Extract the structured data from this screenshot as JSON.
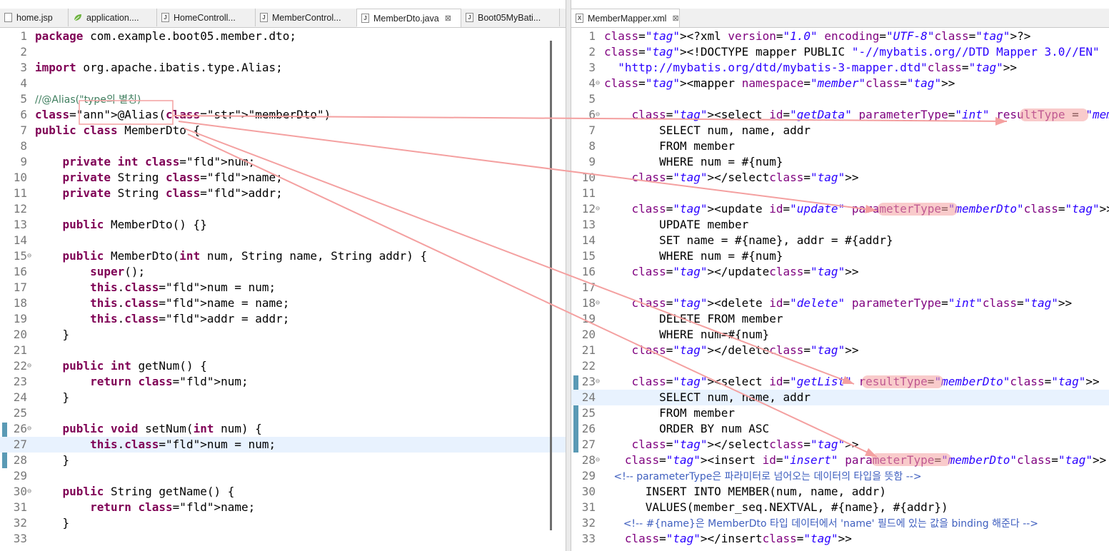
{
  "left_tabs": [
    {
      "label": "home.jsp",
      "icon": "jsp-file-icon",
      "active": false
    },
    {
      "label": "application....",
      "icon": "spring-leaf-icon",
      "active": false
    },
    {
      "label": "HomeControll...",
      "icon": "java-file-icon",
      "active": false
    },
    {
      "label": "MemberControl...",
      "icon": "java-file-icon",
      "active": false
    },
    {
      "label": "MemberDto.java",
      "icon": "java-file-icon",
      "active": true,
      "close": "⊠"
    },
    {
      "label": "Boot05MyBati...",
      "icon": "java-file-icon",
      "active": false
    }
  ],
  "right_tabs": [
    {
      "label": "MemberMapper.xml",
      "icon": "xml-file-icon",
      "active": true,
      "close": "⊠"
    }
  ],
  "java_lines": [
    {
      "n": "1",
      "text": "package com.example.boot05.member.dto;"
    },
    {
      "n": "2",
      "text": ""
    },
    {
      "n": "3",
      "text": "import org.apache.ibatis.type.Alias;"
    },
    {
      "n": "4",
      "text": ""
    },
    {
      "n": "5",
      "text": "//@Alias(\"type의 별칭)"
    },
    {
      "n": "6",
      "text": "@Alias(\"memberDto\")"
    },
    {
      "n": "7",
      "text": "public class MemberDto {"
    },
    {
      "n": "8",
      "text": ""
    },
    {
      "n": "9",
      "text": "    private int num;"
    },
    {
      "n": "10",
      "text": "    private String name;"
    },
    {
      "n": "11",
      "text": "    private String addr;"
    },
    {
      "n": "12",
      "text": ""
    },
    {
      "n": "13",
      "text": "    public MemberDto() {}"
    },
    {
      "n": "14",
      "text": ""
    },
    {
      "n": "15",
      "text": "    public MemberDto(int num, String name, String addr) {",
      "fold": "⊖"
    },
    {
      "n": "16",
      "text": "        super();"
    },
    {
      "n": "17",
      "text": "        this.num = num;"
    },
    {
      "n": "18",
      "text": "        this.name = name;"
    },
    {
      "n": "19",
      "text": "        this.addr = addr;"
    },
    {
      "n": "20",
      "text": "    }"
    },
    {
      "n": "21",
      "text": ""
    },
    {
      "n": "22",
      "text": "    public int getNum() {",
      "fold": "⊖"
    },
    {
      "n": "23",
      "text": "        return num;"
    },
    {
      "n": "24",
      "text": "    }"
    },
    {
      "n": "25",
      "text": ""
    },
    {
      "n": "26",
      "text": "    public void setNum(int num) {",
      "fold": "⊖"
    },
    {
      "n": "27",
      "text": "        this.num = num;",
      "hl": true
    },
    {
      "n": "28",
      "text": "    }"
    },
    {
      "n": "29",
      "text": ""
    },
    {
      "n": "30",
      "text": "    public String getName() {",
      "fold": "⊖"
    },
    {
      "n": "31",
      "text": "        return name;"
    },
    {
      "n": "32",
      "text": "    }"
    },
    {
      "n": "33",
      "text": ""
    }
  ],
  "xml_lines": [
    {
      "n": "1",
      "text": "<?xml version=\"1.0\" encoding=\"UTF-8\"?>"
    },
    {
      "n": "2",
      "text": "<!DOCTYPE mapper PUBLIC \"-//mybatis.org//DTD Mapper 3.0//EN\""
    },
    {
      "n": "3",
      "text": "  \"http://mybatis.org/dtd/mybatis-3-mapper.dtd\">"
    },
    {
      "n": "4",
      "text": "<mapper namespace=\"member\">",
      "fold": "⊖"
    },
    {
      "n": "5",
      "text": ""
    },
    {
      "n": "6",
      "text": "    <select id=\"getData\" parameterType=\"int\" resultType = \"memberDto\">",
      "fold": "⊖"
    },
    {
      "n": "7",
      "text": "        SELECT num, name, addr"
    },
    {
      "n": "8",
      "text": "        FROM member"
    },
    {
      "n": "9",
      "text": "        WHERE num = #{num}"
    },
    {
      "n": "10",
      "text": "    </select>"
    },
    {
      "n": "11",
      "text": ""
    },
    {
      "n": "12",
      "text": "    <update id=\"update\" parameterType=\"memberDto\">",
      "fold": "⊖"
    },
    {
      "n": "13",
      "text": "        UPDATE member"
    },
    {
      "n": "14",
      "text": "        SET name = #{name}, addr = #{addr}"
    },
    {
      "n": "15",
      "text": "        WHERE num = #{num}"
    },
    {
      "n": "16",
      "text": "    </update>"
    },
    {
      "n": "17",
      "text": ""
    },
    {
      "n": "18",
      "text": "    <delete id=\"delete\" parameterType=\"int\">",
      "fold": "⊖"
    },
    {
      "n": "19",
      "text": "        DELETE FROM member"
    },
    {
      "n": "20",
      "text": "        WHERE num=#{num}"
    },
    {
      "n": "21",
      "text": "    </delete>"
    },
    {
      "n": "22",
      "text": ""
    },
    {
      "n": "23",
      "text": "    <select id=\"getList\" resultType=\"memberDto\">",
      "fold": "⊖"
    },
    {
      "n": "24",
      "text": "        SELECT num, name, addr",
      "hl": true
    },
    {
      "n": "25",
      "text": "        FROM member"
    },
    {
      "n": "26",
      "text": "        ORDER BY num ASC"
    },
    {
      "n": "27",
      "text": "    </select>"
    },
    {
      "n": "28",
      "text": "   <insert id=\"insert\" parameterType=\"memberDto\">",
      "fold": "⊖"
    },
    {
      "n": "29",
      "text": "   <!-- parameterType은 파라미터로 넘어오는 데이터의 타입을 뜻함 -->"
    },
    {
      "n": "30",
      "text": "      INSERT INTO MEMBER(num, name, addr)"
    },
    {
      "n": "31",
      "text": "      VALUES(member_seq.NEXTVAL, #{name}, #{addr})"
    },
    {
      "n": "32",
      "text": "      <!-- #{name}은 MemberDto 타입 데이터에서 'name' 필드에 있는 값을 binding 해준다 -->"
    },
    {
      "n": "33",
      "text": "   </insert>"
    }
  ],
  "colors": {
    "annotation": "#f4a0a0",
    "highlight": "#f4a0a0",
    "gutter_mark": "#5a9ab5"
  }
}
